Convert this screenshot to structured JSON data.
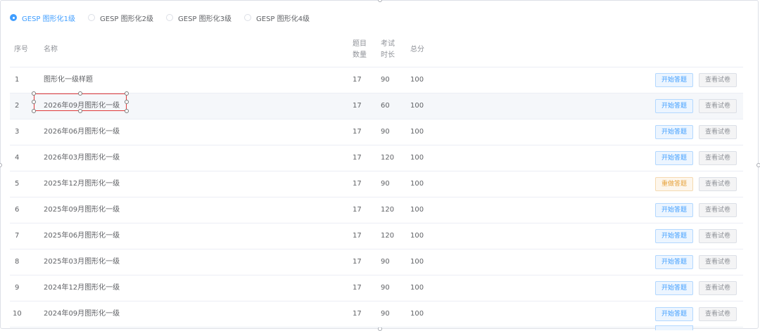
{
  "levels": [
    {
      "label": "GESP 图形化1级",
      "checked": true
    },
    {
      "label": "GESP 图形化2级",
      "checked": false
    },
    {
      "label": "GESP 图形化3级",
      "checked": false
    },
    {
      "label": "GESP 图形化4级",
      "checked": false
    }
  ],
  "table": {
    "headers": {
      "index": "序号",
      "name": "名称",
      "count_line1": "题目",
      "count_line2": "数量",
      "time_line1": "考试",
      "time_line2": "时长",
      "score": "总分"
    },
    "rows": [
      {
        "index": "1",
        "name": "图形化一级样题",
        "count": "17",
        "time": "90",
        "score": "100",
        "action": "开始答题",
        "action_type": "start",
        "view": "查看试卷"
      },
      {
        "index": "2",
        "name": "2026年09月图形化一级",
        "count": "17",
        "time": "60",
        "score": "100",
        "action": "开始答题",
        "action_type": "start",
        "view": "查看试卷"
      },
      {
        "index": "3",
        "name": "2026年06月图形化一级",
        "count": "17",
        "time": "90",
        "score": "100",
        "action": "开始答题",
        "action_type": "start",
        "view": "查看试卷"
      },
      {
        "index": "4",
        "name": "2026年03月图形化一级",
        "count": "17",
        "time": "120",
        "score": "100",
        "action": "开始答题",
        "action_type": "start",
        "view": "查看试卷"
      },
      {
        "index": "5",
        "name": "2025年12月图形化一级",
        "count": "17",
        "time": "90",
        "score": "100",
        "action": "重做答题",
        "action_type": "restart",
        "view": "查看试卷"
      },
      {
        "index": "6",
        "name": "2025年09月图形化一级",
        "count": "17",
        "time": "120",
        "score": "100",
        "action": "开始答题",
        "action_type": "start",
        "view": "查看试卷"
      },
      {
        "index": "7",
        "name": "2025年06月图形化一级",
        "count": "17",
        "time": "120",
        "score": "100",
        "action": "开始答题",
        "action_type": "start",
        "view": "查看试卷"
      },
      {
        "index": "8",
        "name": "2025年03月图形化一级",
        "count": "17",
        "time": "90",
        "score": "100",
        "action": "开始答题",
        "action_type": "start",
        "view": "查看试卷"
      },
      {
        "index": "9",
        "name": "2024年12月图形化一级",
        "count": "17",
        "time": "90",
        "score": "100",
        "action": "开始答题",
        "action_type": "start",
        "view": "查看试卷"
      },
      {
        "index": "10",
        "name": "2024年09月图形化一级",
        "count": "17",
        "time": "90",
        "score": "100",
        "action": "开始答题",
        "action_type": "start",
        "view": "查看试卷"
      }
    ],
    "highlighted_row": 2
  },
  "colors": {
    "primary": "#409eff",
    "warning": "#e6a23c",
    "selection": "#e03a3a"
  }
}
